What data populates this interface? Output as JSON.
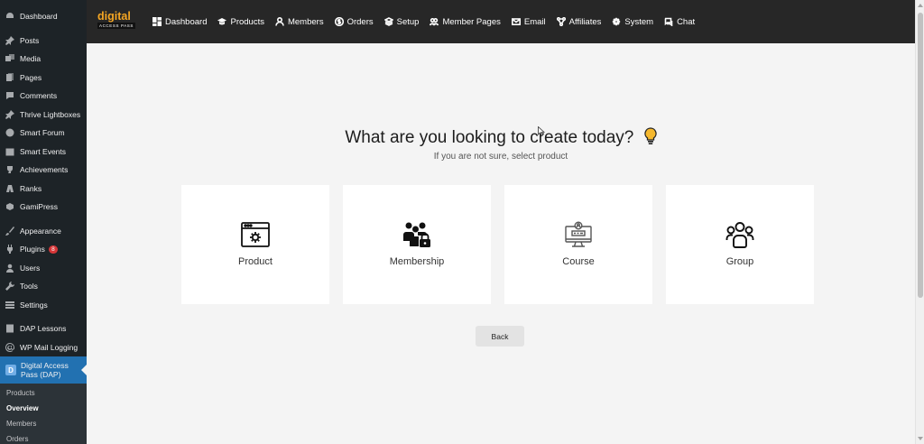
{
  "sidebar": {
    "items": [
      {
        "label": "Dashboard",
        "icon": "dashboard-icon"
      },
      {
        "label": "Posts",
        "icon": "pin-icon"
      },
      {
        "label": "Media",
        "icon": "media-icon"
      },
      {
        "label": "Pages",
        "icon": "pages-icon"
      },
      {
        "label": "Comments",
        "icon": "comments-icon"
      },
      {
        "label": "Thrive Lightboxes",
        "icon": "pin-icon"
      },
      {
        "label": "Smart Forum",
        "icon": "forum-icon"
      },
      {
        "label": "Smart Events",
        "icon": "calendar-icon"
      },
      {
        "label": "Achievements",
        "icon": "trophy-icon"
      },
      {
        "label": "Ranks",
        "icon": "ranks-icon"
      },
      {
        "label": "GamiPress",
        "icon": "gamipress-icon"
      },
      {
        "label": "Appearance",
        "icon": "brush-icon"
      },
      {
        "label": "Plugins",
        "icon": "plugin-icon",
        "badge": "8"
      },
      {
        "label": "Users",
        "icon": "users-icon"
      },
      {
        "label": "Tools",
        "icon": "wrench-icon"
      },
      {
        "label": "Settings",
        "icon": "settings-icon"
      },
      {
        "label": "DAP Lessons",
        "icon": "lessons-icon"
      },
      {
        "label": "WP Mail Logging",
        "icon": "at-icon"
      }
    ],
    "active": {
      "label": "Digital Access Pass (DAP)",
      "logo_letter": "D"
    },
    "submenu": [
      "Products",
      "Overview",
      "Members",
      "Orders"
    ]
  },
  "topbar": {
    "logo_top": "digital",
    "logo_bottom": "ACCESS PASS",
    "nav": [
      {
        "label": "Dashboard",
        "icon": "dashboard-grid-icon"
      },
      {
        "label": "Products",
        "icon": "graduation-cap-icon"
      },
      {
        "label": "Members",
        "icon": "person-icon"
      },
      {
        "label": "Orders",
        "icon": "dollar-circle-icon"
      },
      {
        "label": "Setup",
        "icon": "layers-icon"
      },
      {
        "label": "Member Pages",
        "icon": "people-icon"
      },
      {
        "label": "Email",
        "icon": "envelope-icon"
      },
      {
        "label": "Affiliates",
        "icon": "network-icon"
      },
      {
        "label": "System",
        "icon": "gear-icon"
      },
      {
        "label": "Chat",
        "icon": "chat-icon"
      }
    ]
  },
  "main": {
    "heading": "What are you looking to create today?",
    "subheading": "If you are not sure, select product",
    "cards": [
      {
        "label": "Product",
        "icon": "product-browser-gear-icon"
      },
      {
        "label": "Membership",
        "icon": "membership-lock-icon"
      },
      {
        "label": "Course",
        "icon": "course-monitor-icon"
      },
      {
        "label": "Group",
        "icon": "group-people-icon"
      }
    ],
    "back_label": "Back"
  },
  "colors": {
    "sidebar_bg": "#1d2327",
    "sidebar_active": "#2271b1",
    "topbar_bg": "#272727",
    "logo_accent": "#f5a623",
    "badge": "#d63638",
    "bulb": "#f5b82e"
  }
}
